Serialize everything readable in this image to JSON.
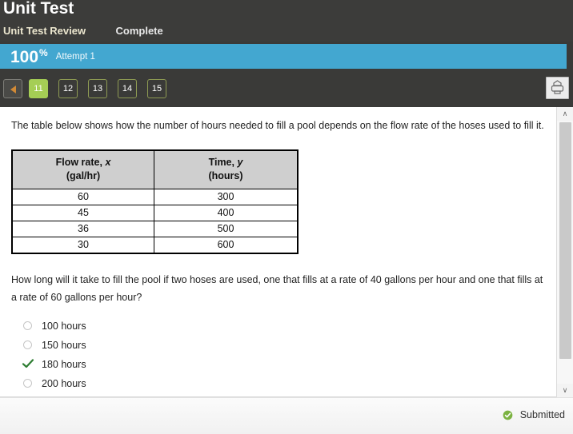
{
  "header": {
    "title": "Unit Test",
    "subtitle": "Unit Test Review",
    "status": "Complete",
    "subtitle_color": "#ece7cf",
    "background_color": "#3c3c3a"
  },
  "score": {
    "percent": "100",
    "percent_symbol": "%",
    "attempt": "Attempt 1",
    "bar_color": "#43a7d0"
  },
  "pager": {
    "prev_icon": "triangle-left-icon",
    "active_page": "11",
    "active_color": "#a5ce55",
    "pages": [
      {
        "label": "11",
        "active": true
      },
      {
        "label": "12",
        "active": false
      },
      {
        "label": "13",
        "active": false
      },
      {
        "label": "14",
        "active": false
      },
      {
        "label": "15",
        "active": false
      }
    ],
    "print_icon": "printer-icon"
  },
  "content": {
    "passage": "The table below shows how the number of hours needed to fill a pool depends on the flow rate of the hoses used to fill it.",
    "table": {
      "headers": [
        {
          "line1_prefix": "Flow rate, ",
          "line1_var": "x",
          "line2": "(gal/hr)"
        },
        {
          "line1_prefix": "Time, ",
          "line1_var": "y",
          "line2": "(hours)"
        }
      ],
      "rows": [
        [
          "60",
          "300"
        ],
        [
          "45",
          "400"
        ],
        [
          "36",
          "500"
        ],
        [
          "30",
          "600"
        ]
      ]
    },
    "question": "How long will it take to fill the pool if two hoses are used, one that fills at a rate of 40 gallons per hour and one that fills at a rate of 60 gallons per hour?",
    "options": [
      {
        "label": "100 hours",
        "marked": false
      },
      {
        "label": "150 hours",
        "marked": false
      },
      {
        "label": "180 hours",
        "marked": true
      },
      {
        "label": "200 hours",
        "marked": false
      }
    ],
    "check_color": "#2e7d32"
  },
  "scrollbar": {
    "up_icon": "chevron-up-icon",
    "down_icon": "chevron-down-icon",
    "up_glyph": "∧",
    "down_glyph": "∨"
  },
  "footer": {
    "status_label": "Submitted",
    "status_icon": "check-circle-icon",
    "status_color": "#7cb342"
  }
}
